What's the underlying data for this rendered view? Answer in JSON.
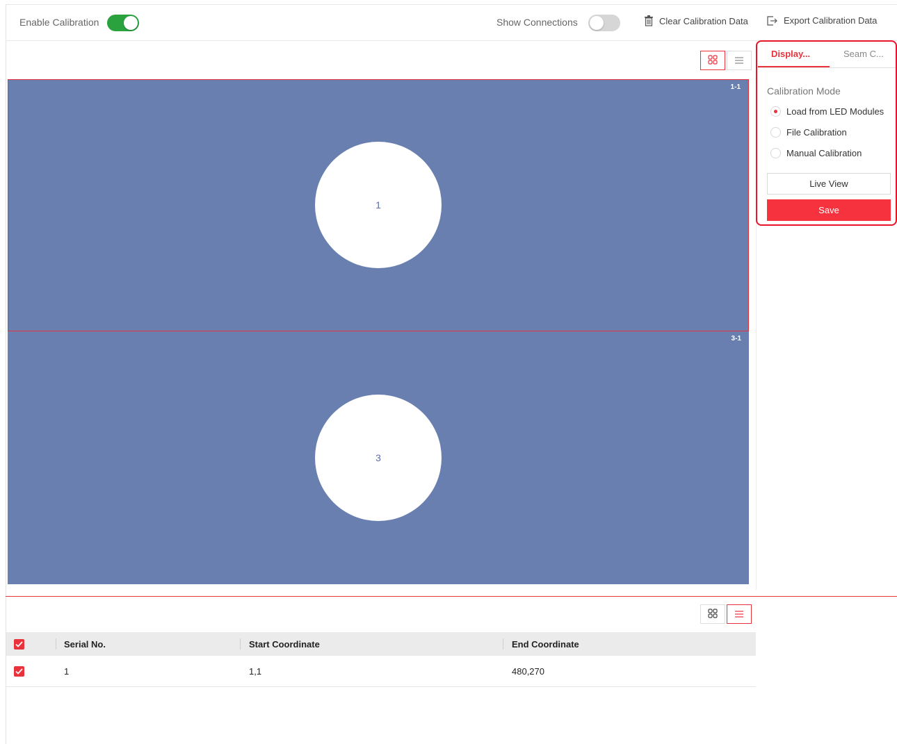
{
  "toolbar": {
    "enable_calibration_label": "Enable Calibration",
    "enable_calibration_on": true,
    "show_connections_label": "Show Connections",
    "show_connections_on": false,
    "clear_label": "Clear Calibration Data",
    "export_label": "Export Calibration Data"
  },
  "canvas": {
    "cells": [
      {
        "tag": "1-1",
        "number": "1",
        "selected": true
      },
      {
        "tag": "3-1",
        "number": "3",
        "selected": false
      }
    ],
    "cell_color": "#687faf"
  },
  "panel": {
    "tabs": [
      {
        "label": "Display...",
        "active": true
      },
      {
        "label": "Seam C...",
        "active": false
      }
    ],
    "section_title": "Calibration Mode",
    "options": [
      {
        "label": "Load from LED Modules",
        "checked": true
      },
      {
        "label": "File Calibration",
        "checked": false
      },
      {
        "label": "Manual Calibration",
        "checked": false
      }
    ],
    "live_view_label": "Live View",
    "save_label": "Save"
  },
  "table": {
    "headers": [
      "Serial No.",
      "Start Coordinate",
      "End Coordinate"
    ],
    "rows": [
      {
        "serial": "1",
        "start": "1,1",
        "end": "480,270",
        "checked": true
      }
    ]
  },
  "colors": {
    "accent": "#e8323c",
    "toggle_on": "#2aa33f"
  },
  "icons": {
    "grid_view": "grid-view-icon",
    "list_view": "list-view-icon",
    "trash": "trash-icon",
    "export": "export-icon",
    "checkbox": "checkbox-checked-icon"
  }
}
